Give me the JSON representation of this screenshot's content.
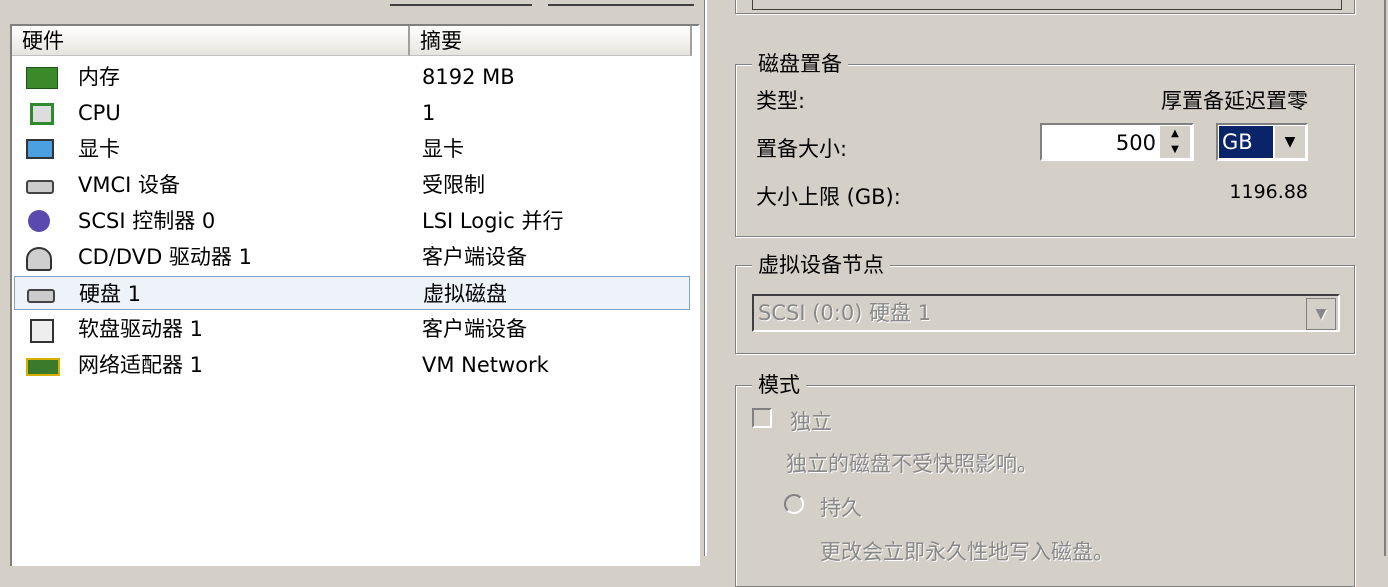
{
  "list": {
    "columns": [
      "硬件",
      "摘要"
    ],
    "rows": [
      {
        "name": "内存",
        "summary": "8192 MB",
        "icon": "memory-icon"
      },
      {
        "name": "CPU",
        "summary": "1",
        "icon": "cpu-icon"
      },
      {
        "name": "显卡",
        "summary": "显卡",
        "icon": "display-icon"
      },
      {
        "name": "VMCI 设备",
        "summary": "受限制",
        "icon": "vmci-icon"
      },
      {
        "name": "SCSI 控制器 0",
        "summary": "LSI Logic 并行",
        "icon": "scsi-icon"
      },
      {
        "name": "CD/DVD 驱动器 1",
        "summary": "客户端设备",
        "icon": "cdrom-icon"
      },
      {
        "name": "硬盘 1",
        "summary": "虚拟磁盘",
        "icon": "harddisk-icon",
        "selected": true
      },
      {
        "name": "软盘驱动器 1",
        "summary": "客户端设备",
        "icon": "floppy-icon"
      },
      {
        "name": "网络适配器 1",
        "summary": "VM Network",
        "icon": "network-icon"
      }
    ]
  },
  "provision": {
    "title": "磁盘置备",
    "type_label": "类型:",
    "type_value": "厚置备延迟置零",
    "size_label": "置备大小:",
    "size_value": "500",
    "unit": "GB",
    "max_label": "大小上限 (GB):",
    "max_value": "1196.88"
  },
  "node": {
    "title": "虚拟设备节点",
    "value": "SCSI (0:0) 硬盘 1"
  },
  "mode": {
    "title": "模式",
    "independent_label": "独立",
    "independent_checked": false,
    "independent_desc": "独立的磁盘不受快照影响。",
    "persistent_label": "持久",
    "persistent_desc": "更改会立即永久性地写入磁盘。"
  },
  "colors": {
    "selection": "#0a246a",
    "background": "#d4d0c8"
  }
}
